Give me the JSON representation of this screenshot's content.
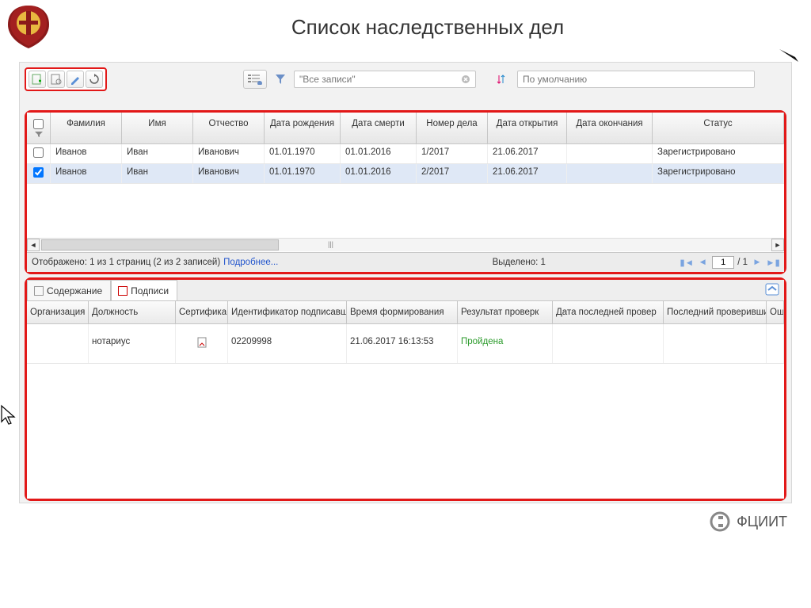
{
  "app": {
    "title": "Список наследственных дел"
  },
  "toolbar": {
    "filter_label": "\"Все записи\"",
    "sort_label": "По умолчанию"
  },
  "grid": {
    "columns": {
      "surname": "Фамилия",
      "name": "Имя",
      "patronymic": "Отчество",
      "birth": "Дата рождения",
      "death": "Дата смерти",
      "caseno": "Номер дела",
      "opened": "Дата открытия",
      "closed": "Дата окончания",
      "status": "Статус"
    },
    "rows": [
      {
        "checked": false,
        "surname": "Иванов",
        "name": "Иван",
        "patronymic": "Иванович",
        "birth": "01.01.1970",
        "death": "01.01.2016",
        "caseno": "1/2017",
        "opened": "21.06.2017",
        "closed": "",
        "status": "Зарегистрировано"
      },
      {
        "checked": true,
        "surname": "Иванов",
        "name": "Иван",
        "patronymic": "Иванович",
        "birth": "01.01.1970",
        "death": "01.01.2016",
        "caseno": "2/2017",
        "opened": "21.06.2017",
        "closed": "",
        "status": "Зарегистрировано"
      }
    ],
    "footer": {
      "displayed": "Отображено: 1 из 1 страниц (2 из 2 записей)",
      "more": "Подробнее...",
      "selected": "Выделено: 1",
      "page": "1",
      "total": "/ 1"
    }
  },
  "tabs": {
    "content": "Содержание",
    "signatures": "Подписи"
  },
  "detail": {
    "columns": {
      "org": "Организация",
      "pos": "Должность",
      "cert": "Сертифика",
      "id": "Идентификатор подписавш",
      "time": "Время формирования",
      "res": "Результат проверк",
      "last": "Дата последней провер",
      "who": "Последний проверивший",
      "err": "Оши"
    },
    "rows": [
      {
        "org": "",
        "pos": "нотариус",
        "cert_icon": true,
        "id": "02209998",
        "time": "21.06.2017 16:13:53",
        "res": "Пройдена",
        "last": "",
        "who": "",
        "err": ""
      }
    ]
  },
  "footer": {
    "brand": "ФЦИИТ"
  }
}
